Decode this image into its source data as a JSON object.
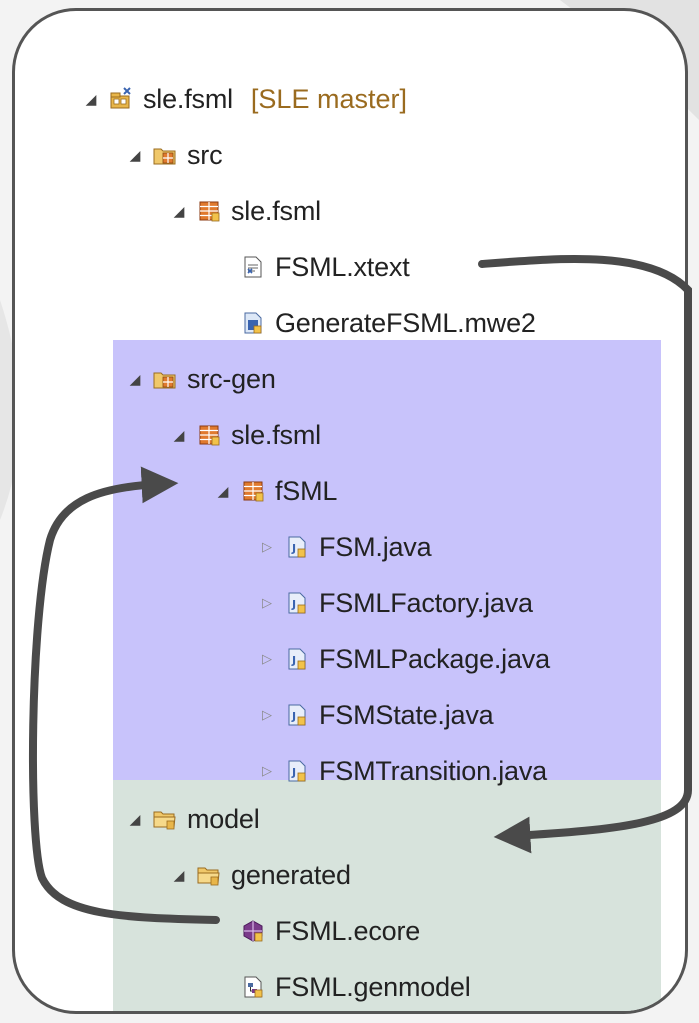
{
  "tree": {
    "root": {
      "label": "sle.fsml",
      "decoration": "[SLE master]",
      "icon": "project-icon"
    },
    "src": {
      "label": "src",
      "icon": "source-folder-icon"
    },
    "src_pkg": {
      "label": "sle.fsml",
      "icon": "package-icon"
    },
    "fsml_xtext": {
      "label": "FSML.xtext",
      "icon": "xtext-file-icon"
    },
    "generate_mwe2": {
      "label": "GenerateFSML.mwe2",
      "icon": "mwe2-file-icon"
    },
    "src_gen": {
      "label": "src-gen",
      "icon": "source-folder-icon"
    },
    "gen_pkg": {
      "label": "sle.fsml",
      "icon": "package-icon"
    },
    "fsml_pkg": {
      "label": "fSML",
      "icon": "package-icon"
    },
    "java_files": [
      {
        "label": "FSM.java"
      },
      {
        "label": "FSMLFactory.java"
      },
      {
        "label": "FSMLPackage.java"
      },
      {
        "label": "FSMState.java"
      },
      {
        "label": "FSMTransition.java"
      }
    ],
    "model": {
      "label": "model",
      "icon": "folder-icon"
    },
    "generated": {
      "label": "generated",
      "icon": "folder-icon"
    },
    "fsml_ecore": {
      "label": "FSML.ecore",
      "icon": "ecore-file-icon"
    },
    "fsml_genmodel": {
      "label": "FSML.genmodel",
      "icon": "genmodel-file-icon"
    }
  },
  "colors": {
    "src_gen_highlight": "#c8c3fb",
    "model_highlight": "#d7e3dc",
    "arrow": "#4a4a4a",
    "decoration": "#9a6b1f"
  }
}
